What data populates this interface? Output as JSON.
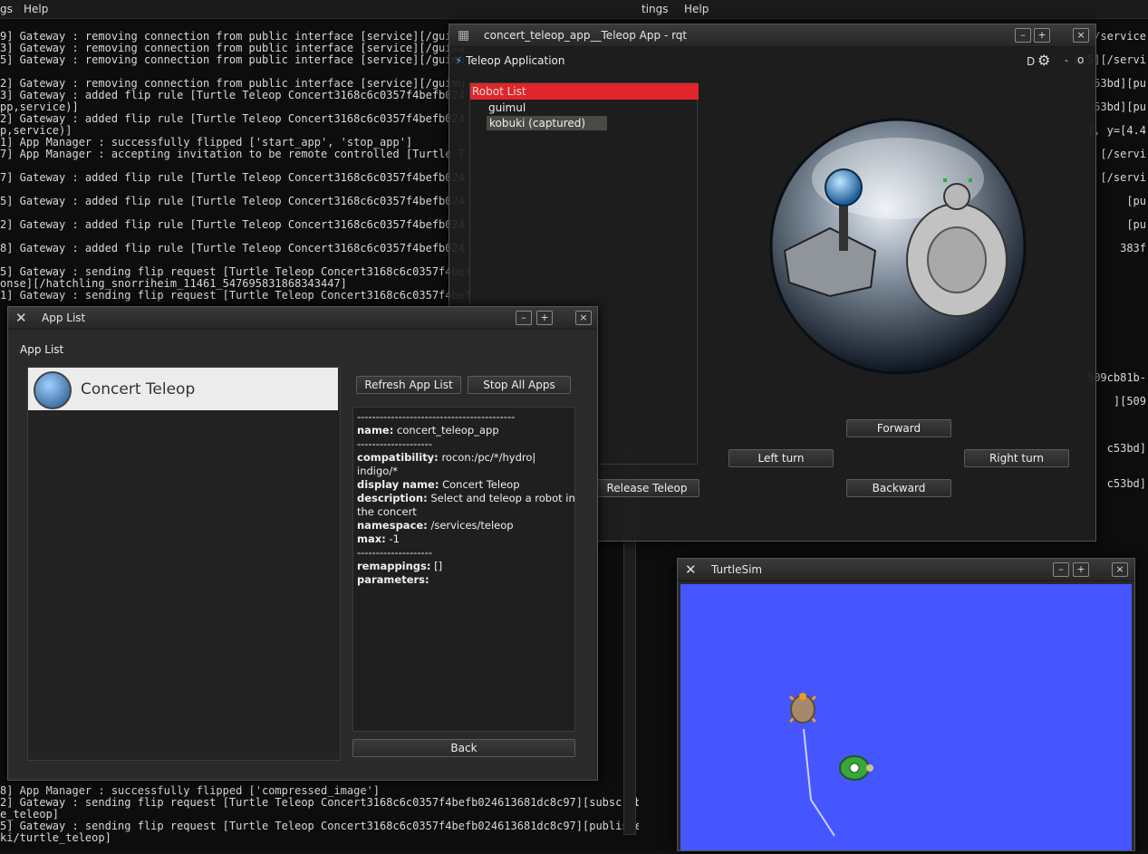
{
  "terminal_left": {
    "menu": [
      "gs",
      "Help"
    ],
    "lines": [
      "9] Gateway : removing connection from public interface [service][/guimu",
      "3] Gateway : removing connection from public interface [service][/guimu",
      "5] Gateway : removing connection from public interface [service][/guimu",
      "",
      "2] Gateway : removing connection from public interface [service][/guimu",
      "3] Gateway : added flip rule [Turtle Teleop Concert3168c6c0357f4befb024",
      "pp,service)]",
      "2] Gateway : added flip rule [Turtle Teleop Concert3168c6c0357f4befb024",
      "p,service)]",
      "1] App Manager : successfully flipped ['start_app', 'stop_app']",
      "7] App Manager : accepting invitation to be remote controlled [Turtle T",
      "",
      "7] Gateway : added flip rule [Turtle Teleop Concert3168c6c0357f4befb024",
      "",
      "5] Gateway : added flip rule [Turtle Teleop Concert3168c6c0357f4befb024",
      "",
      "2] Gateway : added flip rule [Turtle Teleop Concert3168c6c0357f4befb024",
      "",
      "8] Gateway : added flip rule [Turtle Teleop Concert3168c6c0357f4befb024",
      "",
      "5] Gateway : sending flip request [Turtle Teleop Concert3168c6c0357f4bef",
      "onse][/hatchling_snorriheim_11461_547695831868343447]",
      "1] Gateway : sending flip request [Turtle Teleop Concert3168c6c0357f4bef"
    ],
    "bottom_lines": [
      "8] App Manager : successfully flipped ['compressed_image']",
      "2] Gateway : sending flip request [Turtle Teleop Concert3168c6c0357f4befb024613681dc8c97][subscrib",
      "e_teleop]",
      "5] Gateway : sending flip request [Turtle Teleop Concert3168c6c0357f4befb024613681dc8c97][publishe",
      "ki/turtle_teleop]"
    ]
  },
  "terminal_right": {
    "menu": [
      "tings",
      "Help"
    ],
    "lines": [
      "][/service",
      "",
      "ac5][/servi",
      "",
      "53bd][pu",
      "",
      "53bd][pu",
      "",
      "], y=[4.4",
      "",
      "[/servi",
      "",
      "[/servi",
      "",
      "[pu",
      "",
      "[pu",
      "",
      "383f",
      "",
      "",
      "",
      "",
      "",
      "",
      "",
      "",
      "",
      "",
      "509cb81b-",
      "",
      "][509",
      "",
      "",
      "",
      "c53bd]",
      "",
      "",
      "c53bd]"
    ]
  },
  "rqt": {
    "title": "concert_teleop_app__Teleop App - rqt",
    "plugin_title": "Teleop Application",
    "plugin_controls": "D",
    "robot_list_header": "Robot List",
    "robots": [
      "guimul",
      "kobuki (captured)"
    ],
    "buttons": {
      "forward": "Forward",
      "left": "Left turn",
      "right": "Right turn",
      "backward": "Backward",
      "release": "Release Teleop"
    }
  },
  "applist": {
    "title": "App List",
    "section_label": "App List",
    "apps": [
      {
        "name": "Concert Teleop",
        "icon": "rocon-icon"
      }
    ],
    "refresh_label": "Refresh App List",
    "stop_label": "Stop All Apps",
    "back_label": "Back",
    "info": {
      "sep": "------------------------------------------",
      "name_key": "name:",
      "name_val": "concert_teleop_app",
      "sep2": "--------------------",
      "compat_key": "compatibility:",
      "compat_val1": "rocon:/pc/*/hydro|",
      "compat_val2": "indigo/*",
      "display_key": "display name:",
      "display_val": "Concert Teleop",
      "desc_key": "description:",
      "desc_val1": "Select and teleop a robot in",
      "desc_val2": "the concert",
      "ns_key": "namespace:",
      "ns_val": "/services/teleop",
      "max_key": "max:",
      "max_val": "-1",
      "sep3": "--------------------",
      "remap_key": "remappings:",
      "remap_val": "[]",
      "params_key": "parameters:"
    }
  },
  "turtlesim": {
    "title": "TurtleSim",
    "background": "#4556ff"
  },
  "colors": {
    "robot_header": "#e0262b",
    "selected_row": "#4a4a45"
  }
}
